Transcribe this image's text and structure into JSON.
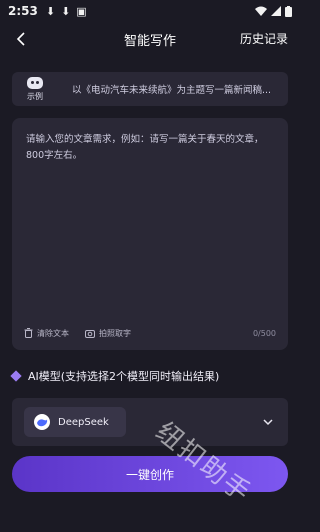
{
  "status_bar": {
    "time": "2:53"
  },
  "nav": {
    "title": "智能写作",
    "history_label": "历史记录"
  },
  "example": {
    "badge_label": "示例",
    "text": "以《电动汽车未来续航》为主题写一篇新闻稿..."
  },
  "editor": {
    "placeholder": "请输入您的文章需求，例如：请写一篇关于春天的文章，800字左右。",
    "clear_label": "清除文本",
    "photo_label": "拍照取字",
    "count": "0/500"
  },
  "model": {
    "label": "AI模型(支持选择2个模型同时输出结果)",
    "selected": "DeepSeek"
  },
  "actions": {
    "create_label": "一键创作"
  },
  "watermark": "纽扣助手",
  "colors": {
    "background": "#1b1a24",
    "card": "#2a2836",
    "accent": "#7d57f0"
  }
}
